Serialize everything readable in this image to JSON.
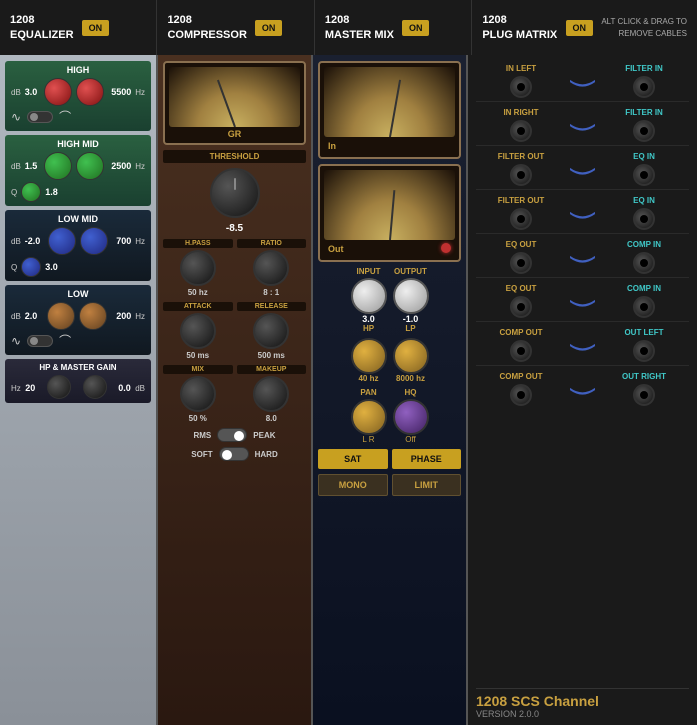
{
  "header": {
    "sections": [
      {
        "id": "eq",
        "line1": "1208",
        "line2": "EQUALIZER",
        "btn": "ON"
      },
      {
        "id": "comp",
        "line1": "1208",
        "line2": "COMPRESSOR",
        "btn": "ON"
      },
      {
        "id": "mix",
        "line1": "1208",
        "line2": "MASTER MIX",
        "btn": "ON"
      },
      {
        "id": "matrix",
        "line1": "1208",
        "line2": "PLUG MATRIX",
        "btn": "ON"
      }
    ],
    "alt_text": "ALT CLICK & DRAG TO\nREMOVE CABLES"
  },
  "eq": {
    "bands": [
      {
        "name": "HIGH",
        "db_label": "dB",
        "db_value": "3.0",
        "freq_value": "5500",
        "freq_label": "Hz"
      },
      {
        "name": "HIGH MID",
        "db_label": "dB",
        "db_value": "1.5",
        "freq_value": "2500",
        "freq_label": "Hz",
        "q_value": "1.8"
      },
      {
        "name": "LOW MID",
        "db_label": "dB",
        "db_value": "-2.0",
        "freq_value": "700",
        "freq_label": "Hz",
        "q_value": "3.0"
      },
      {
        "name": "LOW",
        "db_label": "dB",
        "db_value": "2.0",
        "freq_value": "200",
        "freq_label": "Hz"
      }
    ],
    "hp_master": {
      "label": "HP & MASTER GAIN",
      "hz_label": "Hz",
      "hz_value": "20",
      "db_label": "dB",
      "db_value": "0.0"
    }
  },
  "comp": {
    "gr_label": "GR",
    "threshold_label": "THRESHOLD",
    "threshold_value": "-8.5",
    "hpass_label": "H.PASS",
    "ratio_label": "RATIO",
    "hpass_value": "50 hz",
    "ratio_value": "8 : 1",
    "attack_label": "ATTACK",
    "release_label": "RELEASE",
    "attack_value": "50 ms",
    "release_value": "500 ms",
    "mix_label": "MIX",
    "makeup_label": "MAKEUP",
    "mix_value": "50 %",
    "makeup_value": "8.0",
    "rms_label": "RMS",
    "peak_label": "PEAK",
    "soft_label": "SOFT",
    "hard_label": "HARD"
  },
  "mix": {
    "in_label": "In",
    "out_label": "Out",
    "input_label": "INPUT",
    "output_label": "OUTPUT",
    "input_value": "3.0",
    "output_value": "-1.0",
    "hp_label": "HP",
    "lp_label": "LP",
    "hp_freq": "40 hz",
    "lp_freq": "8000 hz",
    "pan_label": "PAN",
    "hq_label": "HQ",
    "pan_value": "L  R",
    "hq_value": "Off",
    "sat_label": "SAT",
    "phase_label": "PHASE",
    "mono_label": "MONO",
    "limit_label": "LIMIT"
  },
  "matrix": {
    "rows": [
      {
        "left_label": "IN LEFT",
        "left_color": "yellow",
        "right_label": "FILTER IN",
        "right_color": "cyan",
        "has_cable": true
      },
      {
        "left_label": "IN RIGHT",
        "left_color": "yellow",
        "right_label": "FILTER IN",
        "right_color": "cyan",
        "has_cable": true
      },
      {
        "left_label": "FILTER OUT",
        "left_color": "yellow",
        "right_label": "EQ IN",
        "right_color": "cyan",
        "has_cable": true
      },
      {
        "left_label": "FILTER OUT",
        "left_color": "yellow",
        "right_label": "EQ IN",
        "right_color": "cyan",
        "has_cable": true
      },
      {
        "left_label": "EQ OUT",
        "left_color": "yellow",
        "right_label": "COMP IN",
        "right_color": "cyan",
        "has_cable": true
      },
      {
        "left_label": "EQ OUT",
        "left_color": "yellow",
        "right_label": "COMP IN",
        "right_color": "cyan",
        "has_cable": true
      },
      {
        "left_label": "COMP OUT",
        "left_color": "yellow",
        "right_label": "OUT LEFT",
        "right_color": "cyan",
        "has_cable": true
      },
      {
        "left_label": "COMP OUT",
        "left_color": "yellow",
        "right_label": "OUT RIGHT",
        "right_color": "cyan",
        "has_cable": true
      }
    ],
    "brand": "1208 SCS Channel",
    "version": "VERSION 2.0.0"
  }
}
